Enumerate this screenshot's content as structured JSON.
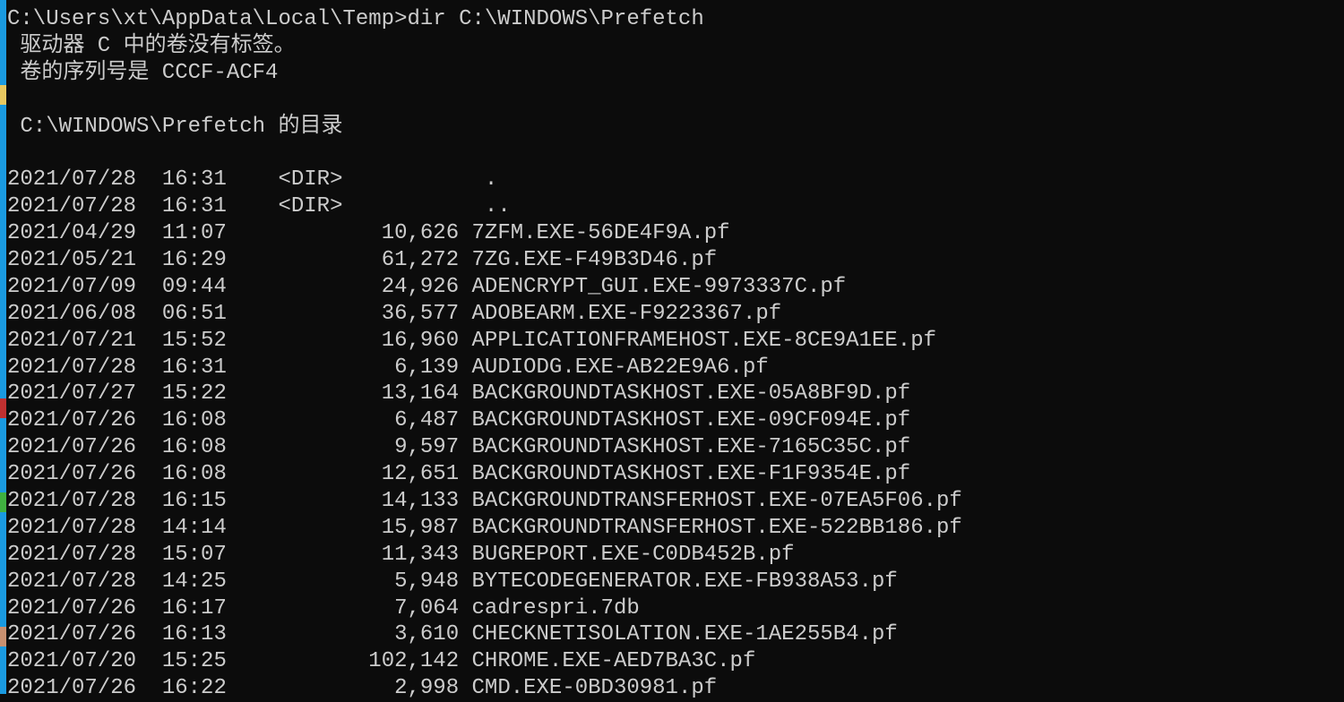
{
  "colors": {
    "background": "#0c0c0c",
    "text": "#cccccc",
    "desktop": "#1a9ae0"
  },
  "console": {
    "prompt": "C:\\Users\\xt\\AppData\\Local\\Temp>dir C:\\WINDOWS\\Prefetch",
    "volume_label": " 驱动器 C 中的卷没有标签。",
    "serial": " 卷的序列号是 CCCF-ACF4",
    "directory_of": " C:\\WINDOWS\\Prefetch 的目录",
    "entries": [
      {
        "date": "2021/07/28",
        "time": "16:31",
        "dir": "<DIR>",
        "size": "",
        "name": "."
      },
      {
        "date": "2021/07/28",
        "time": "16:31",
        "dir": "<DIR>",
        "size": "",
        "name": ".."
      },
      {
        "date": "2021/04/29",
        "time": "11:07",
        "size": "10,626",
        "name": "7ZFM.EXE-56DE4F9A.pf"
      },
      {
        "date": "2021/05/21",
        "time": "16:29",
        "size": "61,272",
        "name": "7ZG.EXE-F49B3D46.pf"
      },
      {
        "date": "2021/07/09",
        "time": "09:44",
        "size": "24,926",
        "name": "ADENCRYPT_GUI.EXE-9973337C.pf"
      },
      {
        "date": "2021/06/08",
        "time": "06:51",
        "size": "36,577",
        "name": "ADOBEARM.EXE-F9223367.pf"
      },
      {
        "date": "2021/07/21",
        "time": "15:52",
        "size": "16,960",
        "name": "APPLICATIONFRAMEHOST.EXE-8CE9A1EE.pf"
      },
      {
        "date": "2021/07/28",
        "time": "16:31",
        "size": "6,139",
        "name": "AUDIODG.EXE-AB22E9A6.pf"
      },
      {
        "date": "2021/07/27",
        "time": "15:22",
        "size": "13,164",
        "name": "BACKGROUNDTASKHOST.EXE-05A8BF9D.pf"
      },
      {
        "date": "2021/07/26",
        "time": "16:08",
        "size": "6,487",
        "name": "BACKGROUNDTASKHOST.EXE-09CF094E.pf"
      },
      {
        "date": "2021/07/26",
        "time": "16:08",
        "size": "9,597",
        "name": "BACKGROUNDTASKHOST.EXE-7165C35C.pf"
      },
      {
        "date": "2021/07/26",
        "time": "16:08",
        "size": "12,651",
        "name": "BACKGROUNDTASKHOST.EXE-F1F9354E.pf"
      },
      {
        "date": "2021/07/28",
        "time": "16:15",
        "size": "14,133",
        "name": "BACKGROUNDTRANSFERHOST.EXE-07EA5F06.pf"
      },
      {
        "date": "2021/07/28",
        "time": "14:14",
        "size": "15,987",
        "name": "BACKGROUNDTRANSFERHOST.EXE-522BB186.pf"
      },
      {
        "date": "2021/07/28",
        "time": "15:07",
        "size": "11,343",
        "name": "BUGREPORT.EXE-C0DB452B.pf"
      },
      {
        "date": "2021/07/28",
        "time": "14:25",
        "size": "5,948",
        "name": "BYTECODEGENERATOR.EXE-FB938A53.pf"
      },
      {
        "date": "2021/07/26",
        "time": "16:17",
        "size": "7,064",
        "name": "cadrespri.7db"
      },
      {
        "date": "2021/07/26",
        "time": "16:13",
        "size": "3,610",
        "name": "CHECKNETISOLATION.EXE-1AE255B4.pf"
      },
      {
        "date": "2021/07/20",
        "time": "15:25",
        "size": "102,142",
        "name": "CHROME.EXE-AED7BA3C.pf"
      },
      {
        "date": "2021/07/26",
        "time": "16:22",
        "size": "2,998",
        "name": "CMD.EXE-0BD30981.pf"
      }
    ]
  }
}
